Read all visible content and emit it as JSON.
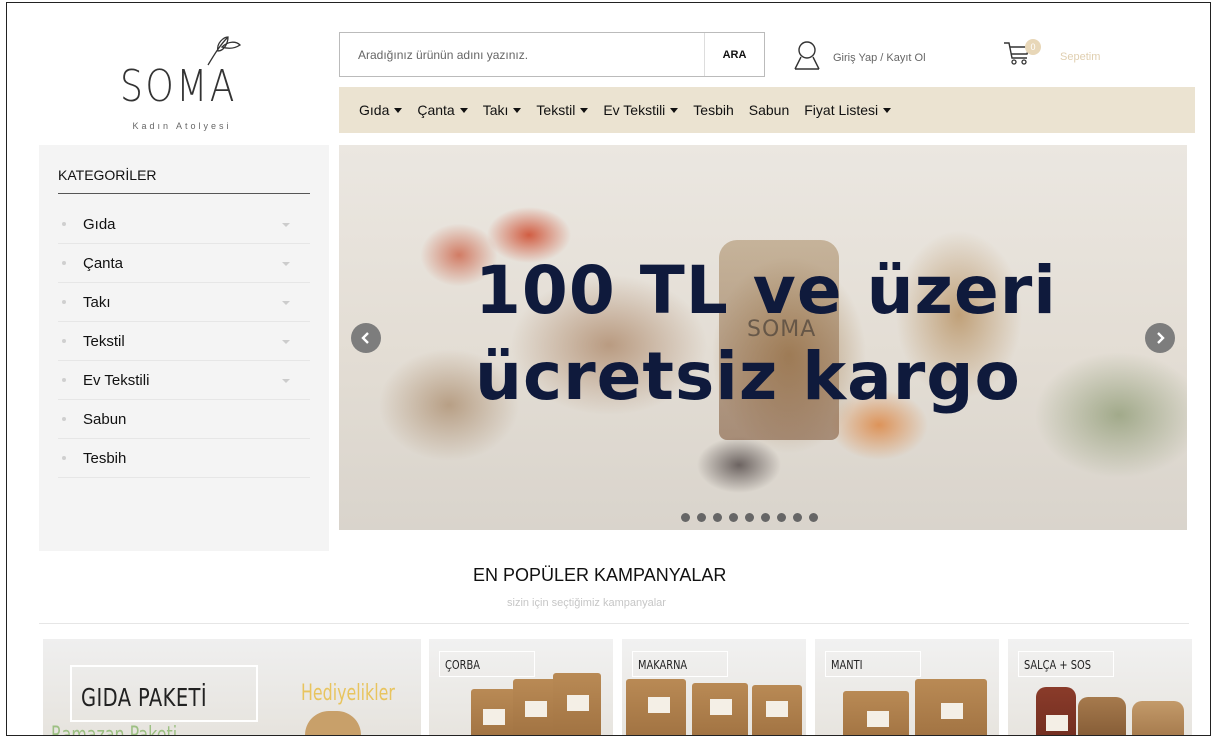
{
  "header": {
    "logo": {
      "brand": "SOMA",
      "tagline": "Kadın Atolyesi"
    },
    "search": {
      "placeholder": "Aradığınız ürünün adını yazınız.",
      "button_label": "ARA"
    },
    "account": {
      "label": "Giriş Yap / Kayıt Ol",
      "icon": "user-icon"
    },
    "cart": {
      "label": "Sepetim",
      "count": "0",
      "icon": "cart-icon"
    }
  },
  "nav": {
    "items": [
      {
        "label": "Gıda",
        "has_dropdown": true
      },
      {
        "label": "Çanta",
        "has_dropdown": true
      },
      {
        "label": "Takı",
        "has_dropdown": true
      },
      {
        "label": "Tekstil",
        "has_dropdown": true
      },
      {
        "label": "Ev Tekstili",
        "has_dropdown": true
      },
      {
        "label": "Tesbih",
        "has_dropdown": false
      },
      {
        "label": "Sabun",
        "has_dropdown": false
      },
      {
        "label": "Fiyat Listesi",
        "has_dropdown": true
      }
    ]
  },
  "sidebar": {
    "title": "KATEGORİLER",
    "items": [
      {
        "label": "Gıda",
        "has_dropdown": true
      },
      {
        "label": "Çanta",
        "has_dropdown": true
      },
      {
        "label": "Takı",
        "has_dropdown": true
      },
      {
        "label": "Tekstil",
        "has_dropdown": true
      },
      {
        "label": "Ev Tekstili",
        "has_dropdown": true
      },
      {
        "label": "Sabun",
        "has_dropdown": false
      },
      {
        "label": "Tesbih",
        "has_dropdown": false
      }
    ]
  },
  "slider": {
    "line1": "100 TL ve üzeri",
    "line2": "ücretsiz kargo",
    "photo_brand": "SOMA",
    "dot_count": 9,
    "prev_icon": "chevron-left-icon",
    "next_icon": "chevron-right-icon"
  },
  "campaigns": {
    "title": "EN POPÜLER KAMPANYALAR",
    "subtitle": "sizin için seçtiğimiz kampanyalar",
    "featured": {
      "title": "GIDA PAKETİ",
      "secondary": "Hediyelikler",
      "tertiary": "Ramazan Paketi"
    },
    "cards": [
      {
        "label": "ÇORBA"
      },
      {
        "label": "MAKARNA"
      },
      {
        "label": "MANTI"
      },
      {
        "label": "SALÇA + SOS"
      }
    ]
  },
  "colors": {
    "nav_background": "#ebe3d1",
    "sidebar_background": "#f4f4f4",
    "slider_text": "#0f1a3c",
    "cart_accent": "#e0cfb0"
  }
}
